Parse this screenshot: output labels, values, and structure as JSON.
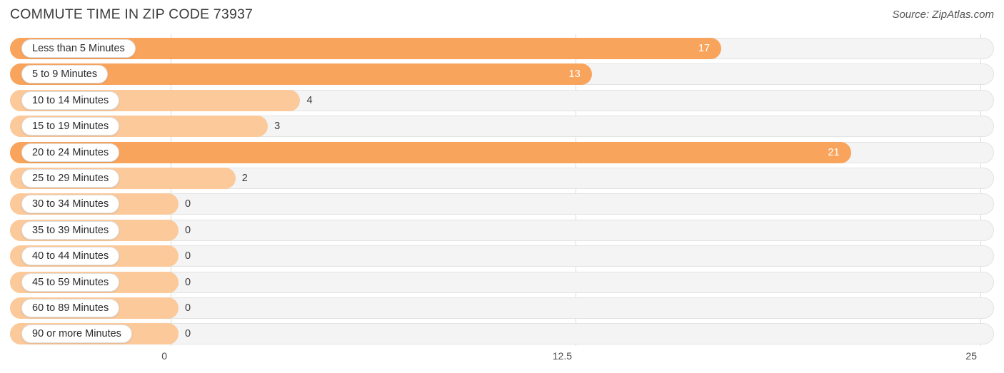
{
  "header": {
    "title": "COMMUTE TIME IN ZIP CODE 73937",
    "source": "Source: ZipAtlas.com"
  },
  "chart_data": {
    "type": "bar",
    "orientation": "horizontal",
    "title": "COMMUTE TIME IN ZIP CODE 73937",
    "xlabel": "",
    "ylabel": "",
    "xlim": [
      0,
      25
    ],
    "grid": true,
    "legend": false,
    "source": "Source: ZipAtlas.com",
    "axis_ticks": [
      "0",
      "12.5",
      "25"
    ],
    "axis_tick_values": [
      0,
      12.5,
      25
    ],
    "categories": [
      "Less than 5 Minutes",
      "5 to 9 Minutes",
      "10 to 14 Minutes",
      "15 to 19 Minutes",
      "20 to 24 Minutes",
      "25 to 29 Minutes",
      "30 to 34 Minutes",
      "35 to 39 Minutes",
      "40 to 44 Minutes",
      "45 to 59 Minutes",
      "60 to 89 Minutes",
      "90 or more Minutes"
    ],
    "values": [
      17,
      13,
      4,
      3,
      21,
      2,
      0,
      0,
      0,
      0,
      0,
      0
    ],
    "value_labels": [
      "17",
      "13",
      "4",
      "3",
      "21",
      "2",
      "0",
      "0",
      "0",
      "0",
      "0",
      "0"
    ],
    "colors": {
      "bar_high": "#f9a45c",
      "bar_low": "#fbc99a",
      "track": "#f4f4f4",
      "track_border": "#e3e3e3",
      "gridline": "#d9d9d9",
      "value_inside": "#ffffff",
      "value_outside": "#3a3a3a",
      "title": "#3c3c3c"
    }
  }
}
